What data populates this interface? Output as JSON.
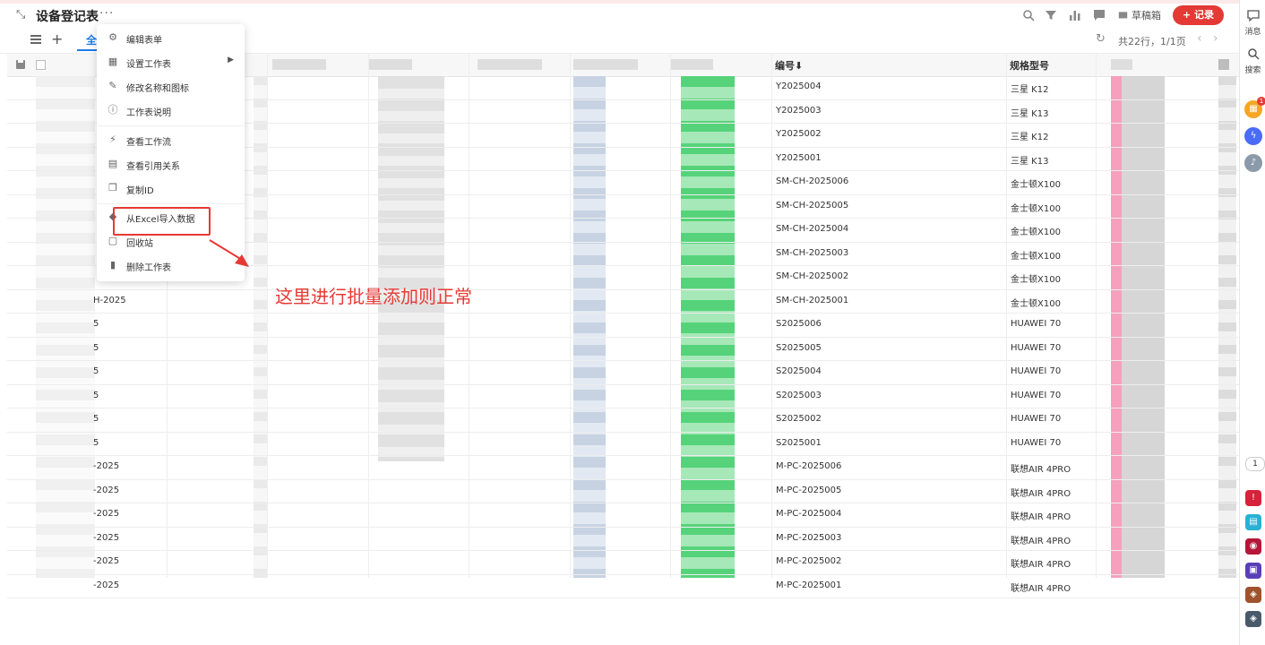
{
  "header": {
    "title": "设备登记表",
    "more": "···",
    "draft_label": "草稿箱",
    "record_button": "+ 记录"
  },
  "subbar": {
    "tab_label": "全",
    "count_text": "共22行，1/1页"
  },
  "columns": {
    "code": "编号⬇",
    "model": "规格型号"
  },
  "rows": [
    {
      "left": "",
      "code": "Y2025004",
      "model": "三星 K12"
    },
    {
      "left": "",
      "code": "Y2025003",
      "model": "三星 K13"
    },
    {
      "left": "",
      "code": "Y2025002",
      "model": "三星 K12"
    },
    {
      "left": "",
      "code": "Y2025001",
      "model": "三星 K13"
    },
    {
      "left": "",
      "code": "SM-CH-2025006",
      "model": "金士顿X100"
    },
    {
      "left": "",
      "code": "SM-CH-2025005",
      "model": "金士顿X100"
    },
    {
      "left": "",
      "code": "SM-CH-2025004",
      "model": "金士顿X100"
    },
    {
      "left": "",
      "code": "SM-CH-2025003",
      "model": "金士顿X100"
    },
    {
      "left": "",
      "code": "SM-CH-2025002",
      "model": "金士顿X100"
    },
    {
      "left": "H-2025",
      "code": "SM-CH-2025001",
      "model": "金士顿X100"
    },
    {
      "left": "5",
      "code": "S2025006",
      "model": "HUAWEI 70"
    },
    {
      "left": "5",
      "code": "S2025005",
      "model": "HUAWEI 70"
    },
    {
      "left": "5",
      "code": "S2025004",
      "model": "HUAWEI 70"
    },
    {
      "left": "5",
      "code": "S2025003",
      "model": "HUAWEI 70"
    },
    {
      "left": "5",
      "code": "S2025002",
      "model": "HUAWEI 70"
    },
    {
      "left": "5",
      "code": "S2025001",
      "model": "HUAWEI 70"
    },
    {
      "left": "-2025",
      "code": "M-PC-2025006",
      "model": "联想AIR 4PRO"
    },
    {
      "left": "-2025",
      "code": "M-PC-2025005",
      "model": "联想AIR 4PRO"
    },
    {
      "left": "-2025",
      "code": "M-PC-2025004",
      "model": "联想AIR 4PRO"
    },
    {
      "left": "-2025",
      "code": "M-PC-2025003",
      "model": "联想AIR 4PRO"
    },
    {
      "left": "-2025",
      "code": "M-PC-2025002",
      "model": "联想AIR 4PRO"
    },
    {
      "left": "-2025",
      "code": "M-PC-2025001",
      "model": "联想AIR 4PRO"
    }
  ],
  "menu": {
    "items": [
      {
        "label": "编辑表单",
        "icon": "gear-icon"
      },
      {
        "label": "设置工作表",
        "icon": "table-icon"
      },
      {
        "label": "修改名称和图标",
        "icon": "pencil-icon"
      },
      {
        "label": "工作表说明",
        "icon": "info-icon"
      },
      {
        "label": "查看工作流",
        "icon": "workflow-icon"
      },
      {
        "label": "查看引用关系",
        "icon": "reference-icon"
      },
      {
        "label": "复制ID",
        "icon": "copy-icon"
      },
      {
        "label": "从Excel导入数据",
        "icon": "import-icon"
      },
      {
        "label": "回收站",
        "icon": "recycle-icon"
      },
      {
        "label": "删除工作表",
        "icon": "trash-icon"
      }
    ]
  },
  "annotation": "这里进行批量添加则正常",
  "rail": {
    "messages": "消息",
    "search": "搜索",
    "badge_count": "1",
    "page_badge": "1"
  },
  "colors": {
    "accent": "#1e7be6",
    "record": "#e53935"
  }
}
